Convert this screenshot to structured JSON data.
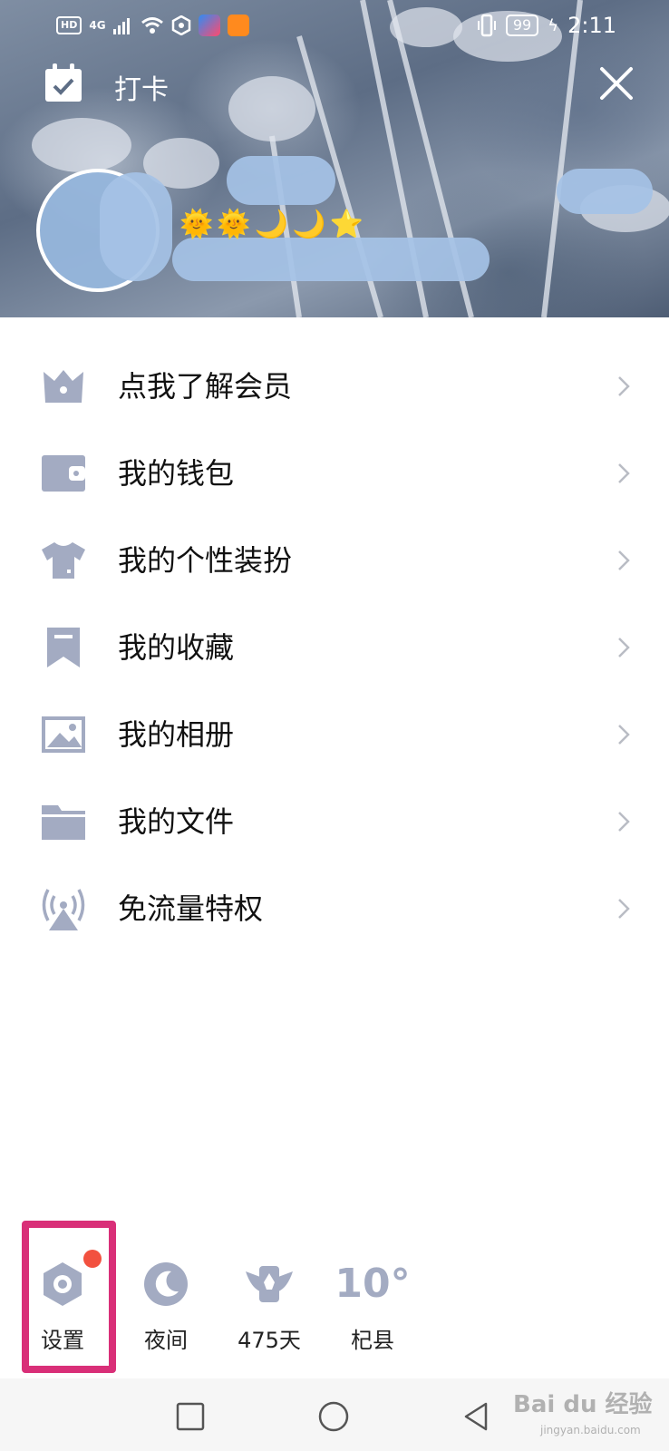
{
  "status_bar": {
    "hd": "HD",
    "network": "4G",
    "battery": "99",
    "time": "2:11"
  },
  "header": {
    "checkin_label": "打卡",
    "level_badges": [
      "🌞",
      "🌞",
      "🌙",
      "🌙",
      "⭐"
    ]
  },
  "menu": [
    {
      "label": "点我了解会员",
      "icon": "crown-icon"
    },
    {
      "label": "我的钱包",
      "icon": "wallet-icon"
    },
    {
      "label": "我的个性装扮",
      "icon": "tshirt-icon"
    },
    {
      "label": "我的收藏",
      "icon": "bookmark-icon"
    },
    {
      "label": "我的相册",
      "icon": "photo-icon"
    },
    {
      "label": "我的文件",
      "icon": "folder-icon"
    },
    {
      "label": "免流量特权",
      "icon": "signal-tower-icon"
    }
  ],
  "quick_actions": {
    "settings": "设置",
    "night": "夜间",
    "days": "475天",
    "weather_temp": "10°",
    "weather_city": "杞县"
  },
  "colors": {
    "icon_gray": "#a3abc2",
    "badge_red": "#f2513f",
    "highlight": "#d92f78",
    "blur_blue": "#a5c2e6"
  },
  "watermark": {
    "brand": "Bai du 经验",
    "url": "jingyan.baidu.com"
  }
}
